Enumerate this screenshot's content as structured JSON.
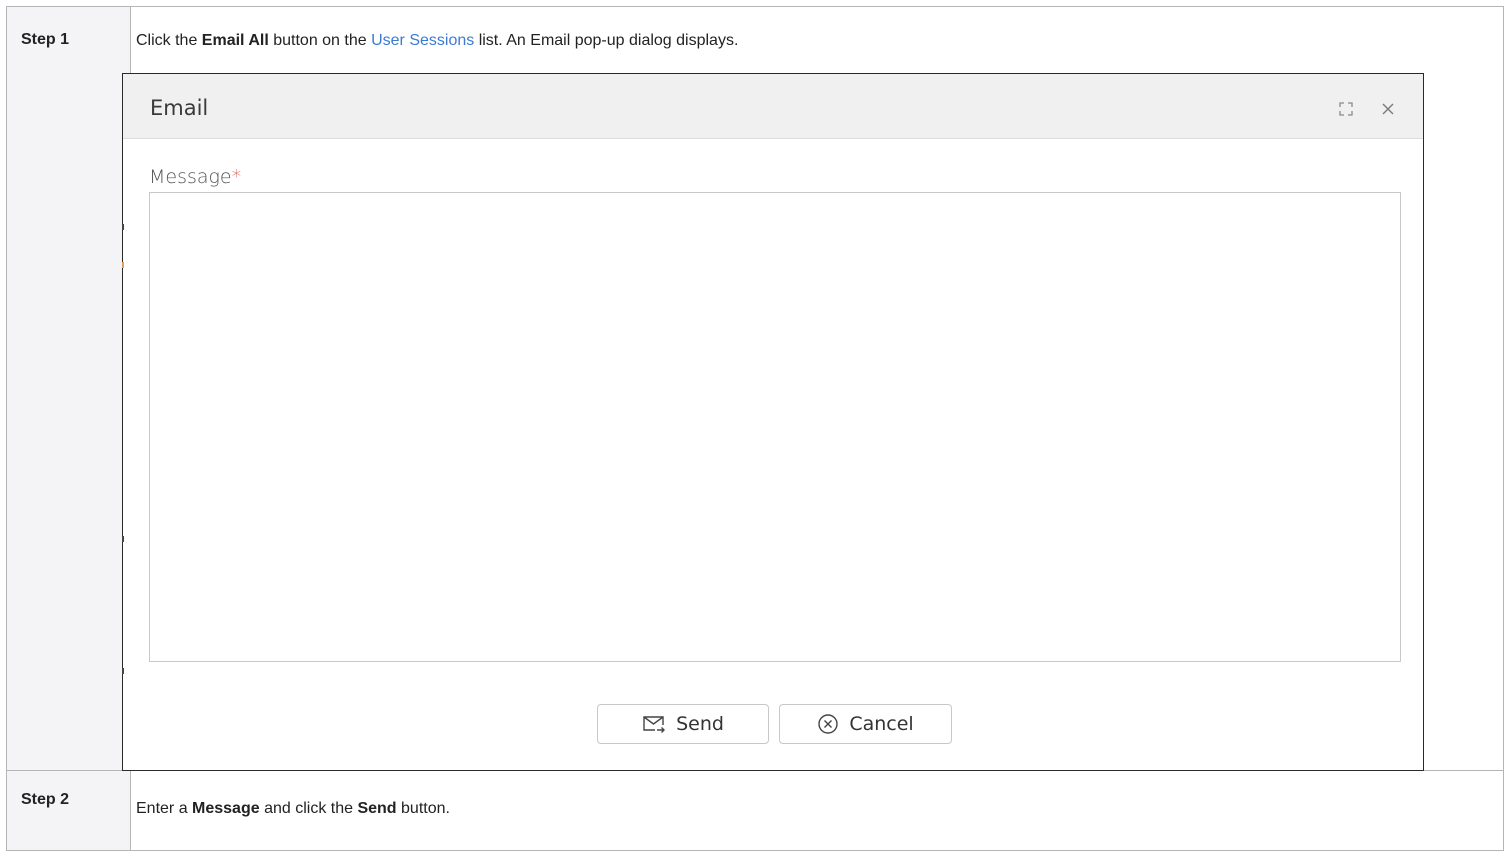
{
  "steps": [
    {
      "label": "Step 1",
      "text_before": "Click the ",
      "bold": "Email All",
      "text_mid": " button on the ",
      "link": "User Sessions",
      "text_after": " list. An Email pop-up dialog displays."
    },
    {
      "label": "Step 2",
      "text_before": "Enter a ",
      "bold1": "Message",
      "text_mid": " and click the ",
      "bold2": "Send",
      "text_after": " button."
    }
  ],
  "dialog": {
    "title": "Email",
    "icons": [
      "maximize-icon",
      "close-icon",
      "send-mail-icon",
      "cancel-circle-icon"
    ],
    "message_label": "Message",
    "required_marker": "*",
    "message_value": "",
    "send_label": "Send",
    "cancel_label": "Cancel"
  },
  "colors": {
    "link": "#3b7bd4",
    "required": "#d9534f",
    "header_bg": "#f0f0f0",
    "step_label_bg": "#f4f4f6"
  }
}
